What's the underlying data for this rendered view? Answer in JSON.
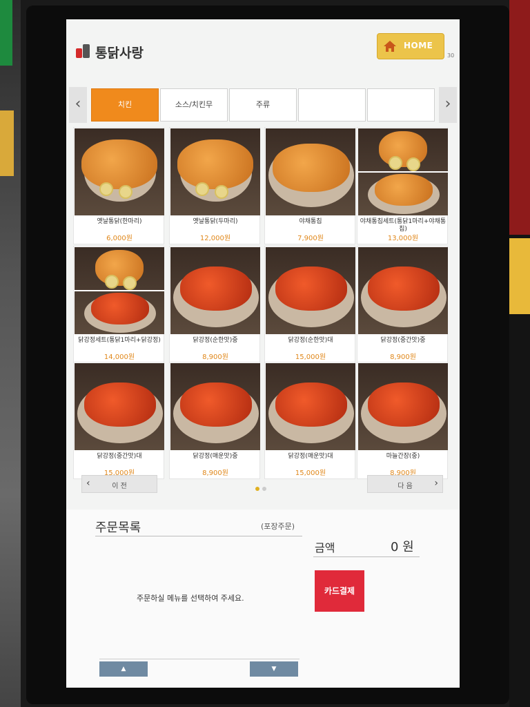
{
  "header": {
    "brand": "통닭사랑",
    "home_label": "HOME",
    "timer": "30"
  },
  "tabs": {
    "prev_icon": "‹",
    "next_icon": "›",
    "items": [
      {
        "label": "치킨",
        "active": true
      },
      {
        "label": "소스/치킨무",
        "active": false
      },
      {
        "label": "주류",
        "active": false
      },
      {
        "label": "",
        "active": false
      },
      {
        "label": "",
        "active": false
      }
    ]
  },
  "menu": {
    "items": [
      {
        "name": "옛날통닭(한마리)",
        "price": "6,000원",
        "style": "whole"
      },
      {
        "name": "옛날통닭(두마리)",
        "price": "12,000원",
        "style": "whole"
      },
      {
        "name": "야채통칩",
        "price": "7,900원",
        "style": "fried"
      },
      {
        "name": "야채통칩세트(통닭1마리+야채통칩)",
        "price": "13,000원",
        "style": "split-fried"
      },
      {
        "name": "닭강정세트(통닭1마리+닭강정)",
        "price": "14,000원",
        "style": "split-sauce"
      },
      {
        "name": "닭강정(순한맛)중",
        "price": "8,900원",
        "style": "sauce"
      },
      {
        "name": "닭강정(순한맛)대",
        "price": "15,000원",
        "style": "sauce"
      },
      {
        "name": "닭강정(중간맛)중",
        "price": "8,900원",
        "style": "sauce"
      },
      {
        "name": "닭강정(중간맛)대",
        "price": "15,000원",
        "style": "sauce"
      },
      {
        "name": "닭강정(매운맛)중",
        "price": "8,900원",
        "style": "sauce"
      },
      {
        "name": "닭강정(매운맛)대",
        "price": "15,000원",
        "style": "sauce"
      },
      {
        "name": "마늘간장(중)",
        "price": "8,900원",
        "style": "sauce"
      }
    ]
  },
  "pager": {
    "prev_label": "이 전",
    "next_label": "다 음",
    "prev_icon": "‹",
    "next_icon": "›",
    "pages": 2,
    "current": 1
  },
  "order": {
    "title": "주문목록",
    "type": "(포장주문)",
    "amount_label": "금액",
    "amount_value": "0 원",
    "message": "주문하실 메뉴를 선택하여 주세요.",
    "pay_label": "카드결제",
    "scroll_up": "▲",
    "scroll_down": "▼"
  },
  "colors": {
    "accent": "#f08a1c",
    "price": "#e0871a",
    "pay": "#e02a3a",
    "home": "#ecc44a"
  }
}
